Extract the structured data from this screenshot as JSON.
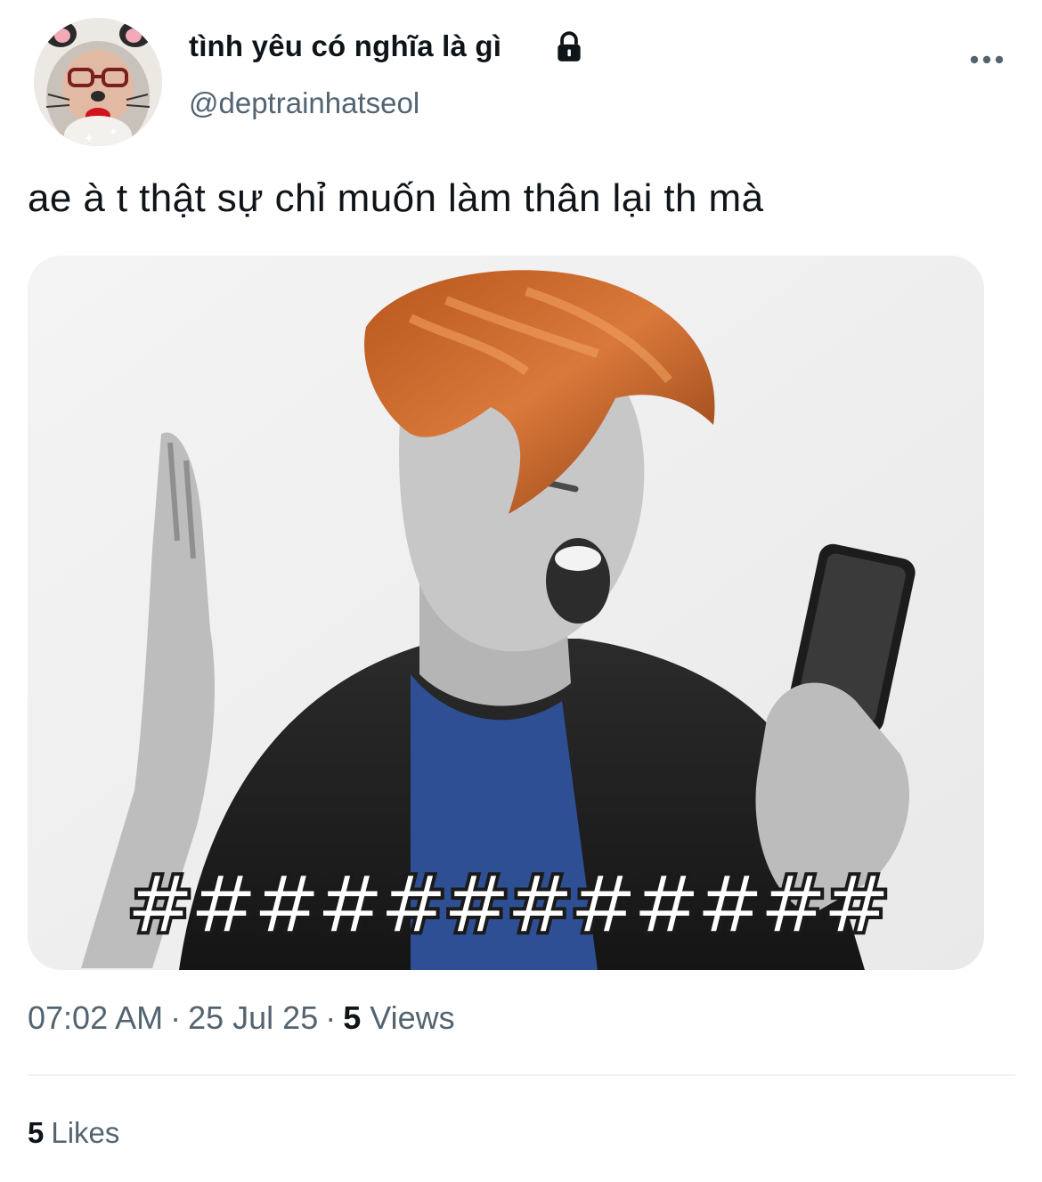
{
  "user": {
    "display_name": "tình yêu có nghĩa là gì",
    "handle": "@deptrainhatseol",
    "avatar_icon": "profile-avatar",
    "protected_icon": "lock-icon"
  },
  "header": {
    "more_icon": "more-options-icon"
  },
  "tweet": {
    "text": "ae à t thật sự chỉ muốn làm thân lại th mà",
    "media": {
      "caption": "############",
      "description_icon": "meme-image"
    }
  },
  "meta": {
    "time": "07:02 AM",
    "separator": "·",
    "date": "25 Jul 25",
    "views_count": "5",
    "views_label": "Views"
  },
  "engagement": {
    "likes_count": "5",
    "likes_label": "Likes"
  },
  "colors": {
    "text_primary": "#0f1419",
    "text_secondary": "#536471",
    "divider": "#eff3f4"
  }
}
